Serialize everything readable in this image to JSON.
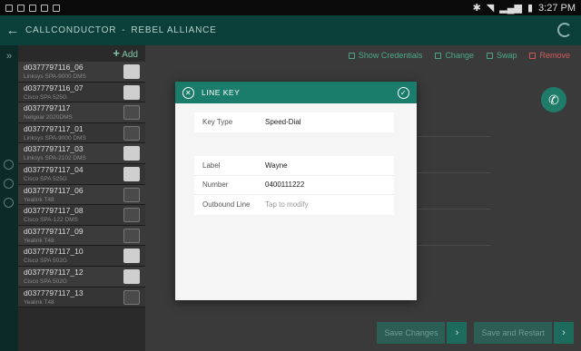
{
  "status": {
    "time": "3:27 PM"
  },
  "header": {
    "app": "CALLCONDUCTOR",
    "separator": "-",
    "org": "REBEL ALLIANCE"
  },
  "devices": {
    "add_label": "Add",
    "items": [
      {
        "name": "d0377797116_06",
        "model": "Linksys SPA-9000 DMS"
      },
      {
        "name": "d0377797116_07",
        "model": "Cisco SPA 525G"
      },
      {
        "name": "d0377797117",
        "model": "Netgear 2020DMS"
      },
      {
        "name": "d0377797117_01",
        "model": "Linksys SPA-9000 DMS"
      },
      {
        "name": "d0377797117_03",
        "model": "Linksys SPA-2102 DMS"
      },
      {
        "name": "d0377797117_04",
        "model": "Cisco SPA 525G"
      },
      {
        "name": "d0377797117_06",
        "model": "Yealink T48"
      },
      {
        "name": "d0377797117_08",
        "model": "Cisco SPA-122 DMS"
      },
      {
        "name": "d0377797117_09",
        "model": "Yealink T48"
      },
      {
        "name": "d0377797117_10",
        "model": "Cisco SPA 502G"
      },
      {
        "name": "d0377797117_12",
        "model": "Cisco SPA 502G"
      },
      {
        "name": "d0377797117_13",
        "model": "Yealink T48"
      }
    ]
  },
  "toolbar": {
    "credentials": "Show Credentials",
    "change": "Change",
    "swap": "Swap",
    "remove": "Remove"
  },
  "footer": {
    "save": "Save Changes",
    "save_restart": "Save and Restart"
  },
  "dialog": {
    "title": "LINE KEY",
    "key_type_label": "Key Type",
    "key_type_value": "Speed-Dial",
    "label_label": "Label",
    "label_value": "Wayne",
    "number_label": "Number",
    "number_value": "0400111222",
    "outbound_label": "Outbound Line",
    "outbound_value": "Tap to modify"
  },
  "colors": {
    "accent": "#1a7c6a",
    "danger": "#d2595b",
    "appbar": "#0b3f3a"
  }
}
